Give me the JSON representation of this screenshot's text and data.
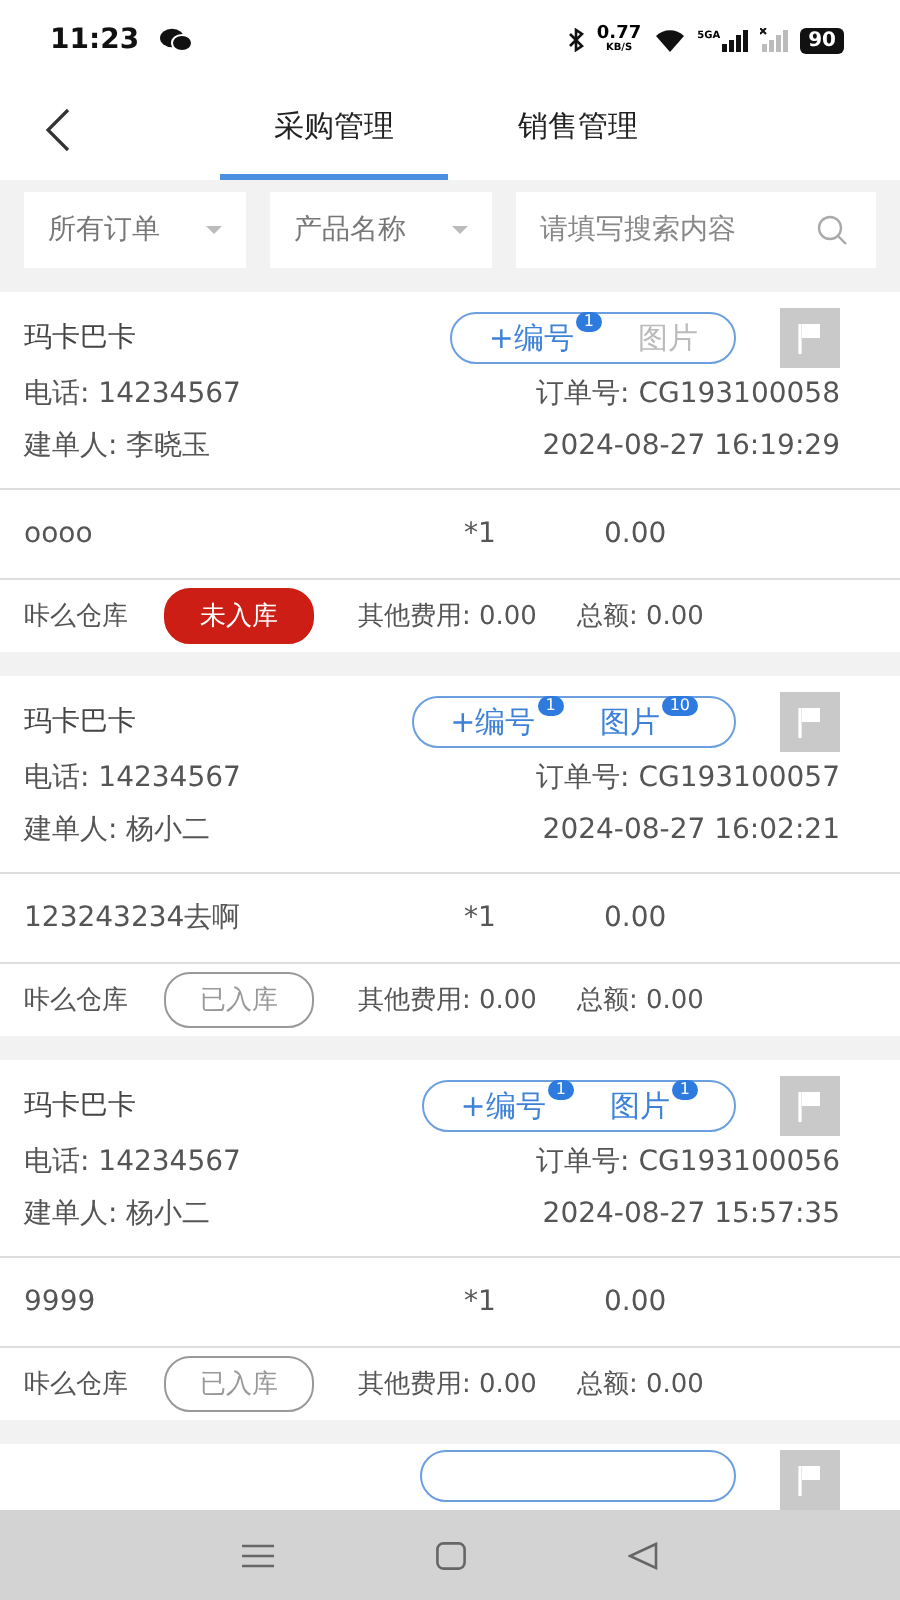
{
  "status_bar": {
    "time": "11:23",
    "speed": "0.77",
    "speed_unit": "KB/S",
    "network": "5GA",
    "battery": "90"
  },
  "tabs": [
    {
      "label": "采购管理",
      "selected": true
    },
    {
      "label": "销售管理",
      "selected": false
    }
  ],
  "filters": [
    {
      "kind": "dropdown",
      "value": "所有订单"
    },
    {
      "kind": "dropdown",
      "value": "产品名称"
    },
    {
      "kind": "search",
      "placeholder": "请填写搜索内容"
    }
  ],
  "orders": [
    {
      "customer": "玛卡巴卡",
      "code_label": "+编号",
      "code_count": "1",
      "picture_label": "图片",
      "phone": "电话: 14234567",
      "order_no": "订单号: CG193100058",
      "creator": "建单人: 李晓玉",
      "created": "2024-08-27 16:19:29",
      "product": "oooo",
      "quantity": "*1",
      "price": "0.00",
      "warehouse": "咔么仓库",
      "stored": false,
      "stored_label": "未入库",
      "other_fees": "其他费用: 0.00",
      "total": "总额: 0.00"
    },
    {
      "customer": "玛卡巴卡",
      "code_label": "+编号",
      "code_count": "1",
      "picture_label": "图片",
      "picture_count": "10",
      "phone": "电话: 14234567",
      "order_no": "订单号: CG193100057",
      "creator": "建单人: 杨小二",
      "created": "2024-08-27 16:02:21",
      "product": "123243234去啊",
      "quantity": "*1",
      "price": "0.00",
      "warehouse": "咔么仓库",
      "stored": true,
      "stored_label": "已入库",
      "other_fees": "其他费用: 0.00",
      "total": "总额: 0.00"
    },
    {
      "customer": "玛卡巴卡",
      "code_label": "+编号",
      "code_count": "1",
      "picture_label": "图片",
      "picture_count": "1",
      "phone": "电话: 14234567",
      "order_no": "订单号: CG193100056",
      "creator": "建单人: 杨小二",
      "created": "2024-08-27 15:57:35",
      "product": "9999",
      "quantity": "*1",
      "price": "0.00",
      "warehouse": "咔么仓库",
      "stored": true,
      "stored_label": "已入库",
      "other_fees": "其他费用: 0.00",
      "total": "总额: 0.00"
    }
  ]
}
